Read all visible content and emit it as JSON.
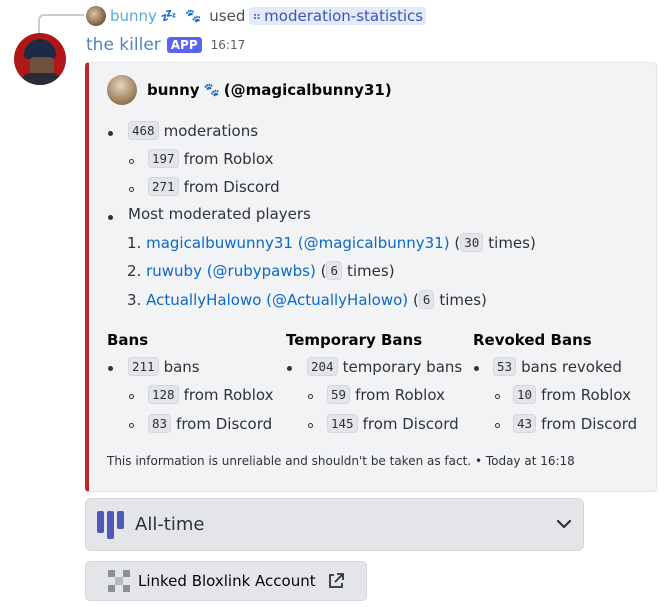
{
  "reply": {
    "username": "bunny",
    "emoji_a": "💤",
    "emoji_b": "🐾",
    "used_text": "used",
    "command": "moderation-statistics"
  },
  "author": {
    "name": "the killer",
    "tag": "APP",
    "time": "16:17"
  },
  "embed": {
    "accent_color": "#c0262d",
    "author_name": "bunny",
    "author_emoji": "🐾",
    "author_handle": "(@magicalbunny31)",
    "moderations_count": "468",
    "moderations_label": "moderations",
    "from_roblox_count": "197",
    "from_roblox_label": "from Roblox",
    "from_discord_count": "271",
    "from_discord_label": "from Discord",
    "most_moderated_label": "Most moderated players",
    "players": [
      {
        "num": "1.",
        "name": "magicalbuwunny31 (@magicalbunny31)",
        "open": "(",
        "count": "30",
        "times": "times)"
      },
      {
        "num": "2.",
        "name": "ruwuby (@rubypawbs)",
        "open": "(",
        "count": "6",
        "times": "times)"
      },
      {
        "num": "3.",
        "name": "ActuallyHalowo (@ActuallyHalowo)",
        "open": "(",
        "count": "6",
        "times": "times)"
      }
    ],
    "columns": [
      {
        "title": "Bans",
        "total": "211",
        "total_label": "bans",
        "roblox": "128",
        "roblox_label": "from Roblox",
        "discord": "83",
        "discord_label": "from Discord"
      },
      {
        "title": "Temporary Bans",
        "total": "204",
        "total_label": "temporary bans",
        "roblox": "59",
        "roblox_label": "from Roblox",
        "discord": "145",
        "discord_label": "from Discord"
      },
      {
        "title": "Revoked Bans",
        "total": "53",
        "total_label": "bans revoked",
        "roblox": "10",
        "roblox_label": "from Roblox",
        "discord": "43",
        "discord_label": "from Discord"
      }
    ],
    "footer": "This information is unreliable and shouldn't be taken as fact. • Today at 16:18"
  },
  "select_menu": {
    "value": "All-time",
    "icon": "bar-chart-icon"
  },
  "link_button": {
    "label": "Linked Bloxlink Account",
    "icon": "bloxlink-icon",
    "external_icon": "external-link-icon"
  }
}
